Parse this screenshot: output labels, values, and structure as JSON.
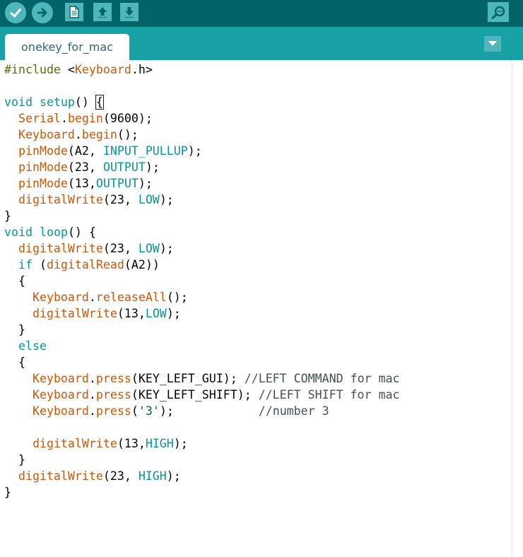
{
  "toolbar": {
    "buttons": [
      {
        "name": "verify-button",
        "icon": "checkmark-icon"
      },
      {
        "name": "upload-button",
        "icon": "arrow-right-icon"
      },
      {
        "name": "new-button",
        "icon": "new-file-icon"
      },
      {
        "name": "open-button",
        "icon": "open-arrow-up-icon"
      },
      {
        "name": "save-button",
        "icon": "save-arrow-down-icon"
      },
      {
        "name": "serial-monitor-button",
        "icon": "magnifier-icon"
      }
    ]
  },
  "tab": {
    "label": "onekey_for_mac",
    "menu_icon": "triangle-down-icon"
  },
  "colors": {
    "toolbar_bg": "#006468",
    "tabbar_bg": "#17a1a5",
    "button_bg": "#4db7bb",
    "keyword": "#00979c",
    "function": "#d35400",
    "comment": "#434f54",
    "string": "#005c5f",
    "preprocessor": "#5e6d03"
  },
  "code_lines": [
    [
      [
        "pp",
        "#include"
      ],
      [
        "pl",
        " <"
      ],
      [
        "fn",
        "Keyboard"
      ],
      [
        "pl",
        ".h>"
      ]
    ],
    [],
    [
      [
        "kw",
        "void"
      ],
      [
        "pl",
        " "
      ],
      [
        "kw",
        "setup"
      ],
      [
        "pl",
        "() "
      ],
      [
        "cursor",
        "{"
      ]
    ],
    [
      [
        "pl",
        "  "
      ],
      [
        "fn",
        "Serial"
      ],
      [
        "pl",
        "."
      ],
      [
        "fn",
        "begin"
      ],
      [
        "pl",
        "(9600);"
      ]
    ],
    [
      [
        "pl",
        "  "
      ],
      [
        "fn",
        "Keyboard"
      ],
      [
        "pl",
        "."
      ],
      [
        "fn",
        "begin"
      ],
      [
        "pl",
        "();"
      ]
    ],
    [
      [
        "pl",
        "  "
      ],
      [
        "fn",
        "pinMode"
      ],
      [
        "pl",
        "(A2, "
      ],
      [
        "kw",
        "INPUT_PULLUP"
      ],
      [
        "pl",
        ");"
      ]
    ],
    [
      [
        "pl",
        "  "
      ],
      [
        "fn",
        "pinMode"
      ],
      [
        "pl",
        "(23, "
      ],
      [
        "kw",
        "OUTPUT"
      ],
      [
        "pl",
        ");"
      ]
    ],
    [
      [
        "pl",
        "  "
      ],
      [
        "fn",
        "pinMode"
      ],
      [
        "pl",
        "(13,"
      ],
      [
        "kw",
        "OUTPUT"
      ],
      [
        "pl",
        ");"
      ]
    ],
    [
      [
        "pl",
        "  "
      ],
      [
        "fn",
        "digitalWrite"
      ],
      [
        "pl",
        "(23, "
      ],
      [
        "kw",
        "LOW"
      ],
      [
        "pl",
        ");"
      ]
    ],
    [
      [
        "pl",
        "}"
      ]
    ],
    [
      [
        "kw",
        "void"
      ],
      [
        "pl",
        " "
      ],
      [
        "kw",
        "loop"
      ],
      [
        "pl",
        "() {"
      ]
    ],
    [
      [
        "pl",
        "  "
      ],
      [
        "fn",
        "digitalWrite"
      ],
      [
        "pl",
        "(23, "
      ],
      [
        "kw",
        "LOW"
      ],
      [
        "pl",
        ");"
      ]
    ],
    [
      [
        "pl",
        "  "
      ],
      [
        "kw",
        "if"
      ],
      [
        "pl",
        " ("
      ],
      [
        "fn",
        "digitalRead"
      ],
      [
        "pl",
        "(A2))"
      ]
    ],
    [
      [
        "pl",
        "  {"
      ]
    ],
    [
      [
        "pl",
        "    "
      ],
      [
        "fn",
        "Keyboard"
      ],
      [
        "pl",
        "."
      ],
      [
        "fn",
        "releaseAll"
      ],
      [
        "pl",
        "();"
      ]
    ],
    [
      [
        "pl",
        "    "
      ],
      [
        "fn",
        "digitalWrite"
      ],
      [
        "pl",
        "(13,"
      ],
      [
        "kw",
        "LOW"
      ],
      [
        "pl",
        ");"
      ]
    ],
    [
      [
        "pl",
        "  }"
      ]
    ],
    [
      [
        "pl",
        "  "
      ],
      [
        "kw",
        "else"
      ]
    ],
    [
      [
        "pl",
        "  {"
      ]
    ],
    [
      [
        "pl",
        "    "
      ],
      [
        "fn",
        "Keyboard"
      ],
      [
        "pl",
        "."
      ],
      [
        "fn",
        "press"
      ],
      [
        "pl",
        "(KEY_LEFT_GUI); "
      ],
      [
        "cm",
        "//LEFT COMMAND for mac"
      ]
    ],
    [
      [
        "pl",
        "    "
      ],
      [
        "fn",
        "Keyboard"
      ],
      [
        "pl",
        "."
      ],
      [
        "fn",
        "press"
      ],
      [
        "pl",
        "(KEY_LEFT_SHIFT); "
      ],
      [
        "cm",
        "//LEFT SHIFT for mac"
      ]
    ],
    [
      [
        "pl",
        "    "
      ],
      [
        "fn",
        "Keyboard"
      ],
      [
        "pl",
        "."
      ],
      [
        "fn",
        "press"
      ],
      [
        "pl",
        "("
      ],
      [
        "st",
        "'3'"
      ],
      [
        "pl",
        ");            "
      ],
      [
        "cm",
        "//number 3"
      ]
    ],
    [],
    [
      [
        "pl",
        "    "
      ],
      [
        "fn",
        "digitalWrite"
      ],
      [
        "pl",
        "(13,"
      ],
      [
        "kw",
        "HIGH"
      ],
      [
        "pl",
        ");"
      ]
    ],
    [
      [
        "pl",
        "  }"
      ]
    ],
    [
      [
        "pl",
        "  "
      ],
      [
        "fn",
        "digitalWrite"
      ],
      [
        "pl",
        "(23, "
      ],
      [
        "kw",
        "HIGH"
      ],
      [
        "pl",
        ");"
      ]
    ],
    [
      [
        "pl",
        "}"
      ]
    ]
  ]
}
